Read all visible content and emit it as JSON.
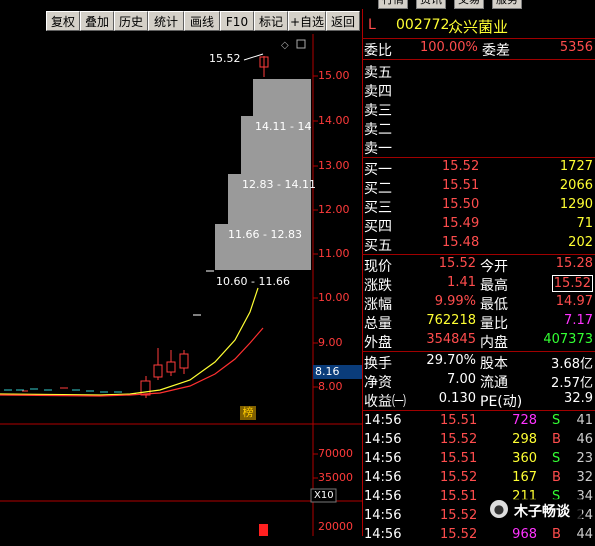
{
  "window": {
    "top_buttons": [
      "行情",
      "资讯",
      "交易",
      "服务"
    ]
  },
  "toolbar": {
    "buttons": [
      "复权",
      "叠加",
      "历史",
      "统计",
      "画线",
      "F10",
      "标记",
      "+自选",
      "返回"
    ]
  },
  "chart": {
    "price_axis": [
      "15.00",
      "14.00",
      "13.00",
      "12.00",
      "11.00",
      "10.00",
      "9.00",
      "8.00"
    ],
    "current_price_tag": "8.16",
    "high_label": "15.52",
    "price_ranges": [
      "14.11 - 14",
      "12.83 - 14.11",
      "11.66 - 12.83",
      "10.60 - 11.66"
    ],
    "rank_badge": "榜",
    "volume_axis": [
      "70000",
      "35000",
      "20000"
    ],
    "volume_unit": "X10"
  },
  "header": {
    "market": "L",
    "code": "002772",
    "name": "众兴菌业"
  },
  "order_ratio": {
    "label1": "委比",
    "value1": "100.00%",
    "label2": "委差",
    "value2": "5356"
  },
  "asks": [
    {
      "label": "卖五",
      "price": "",
      "vol": ""
    },
    {
      "label": "卖四",
      "price": "",
      "vol": ""
    },
    {
      "label": "卖三",
      "price": "",
      "vol": ""
    },
    {
      "label": "卖二",
      "price": "",
      "vol": ""
    },
    {
      "label": "卖一",
      "price": "",
      "vol": ""
    }
  ],
  "bids": [
    {
      "label": "买一",
      "price": "15.52",
      "vol": "1727"
    },
    {
      "label": "买二",
      "price": "15.51",
      "vol": "2066"
    },
    {
      "label": "买三",
      "price": "15.50",
      "vol": "1290"
    },
    {
      "label": "买四",
      "price": "15.49",
      "vol": "71"
    },
    {
      "label": "买五",
      "price": "15.48",
      "vol": "202"
    }
  ],
  "stats1": [
    {
      "l1": "现价",
      "v1": "15.52",
      "l2": "今开",
      "v2": "15.28"
    },
    {
      "l1": "涨跌",
      "v1": "1.41",
      "l2": "最高",
      "v2": "15.52"
    },
    {
      "l1": "涨幅",
      "v1": "9.99%",
      "l2": "最低",
      "v2": "14.97"
    },
    {
      "l1": "总量",
      "v1": "762218",
      "l2": "量比",
      "v2": "7.17"
    },
    {
      "l1": "外盘",
      "v1": "354845",
      "l2": "内盘",
      "v2": "407373"
    }
  ],
  "stats2": [
    {
      "l1": "换手",
      "v1": "29.70%",
      "l2": "股本",
      "v2": "3.68亿"
    },
    {
      "l1": "净资",
      "v1": "7.00",
      "l2": "流通",
      "v2": "2.57亿"
    },
    {
      "l1": "收益㈠",
      "v1": "0.130",
      "l2": "PE(动)",
      "v2": "32.9"
    }
  ],
  "ticks": [
    {
      "time": "14:56",
      "price": "15.51",
      "vol": "728",
      "side": "S",
      "num": "41"
    },
    {
      "time": "14:56",
      "price": "15.52",
      "vol": "298",
      "side": "B",
      "num": "46"
    },
    {
      "time": "14:56",
      "price": "15.51",
      "vol": "360",
      "side": "S",
      "num": "23"
    },
    {
      "time": "14:56",
      "price": "15.52",
      "vol": "167",
      "side": "B",
      "num": "32"
    },
    {
      "time": "14:56",
      "price": "15.51",
      "vol": "211",
      "side": "S",
      "num": "34"
    },
    {
      "time": "14:56",
      "price": "15.52",
      "vol": "",
      "side": "",
      "num": "24"
    },
    {
      "time": "14:56",
      "price": "15.52",
      "vol": "968",
      "side": "B",
      "num": "44"
    }
  ],
  "watermark": "木子畅谈"
}
